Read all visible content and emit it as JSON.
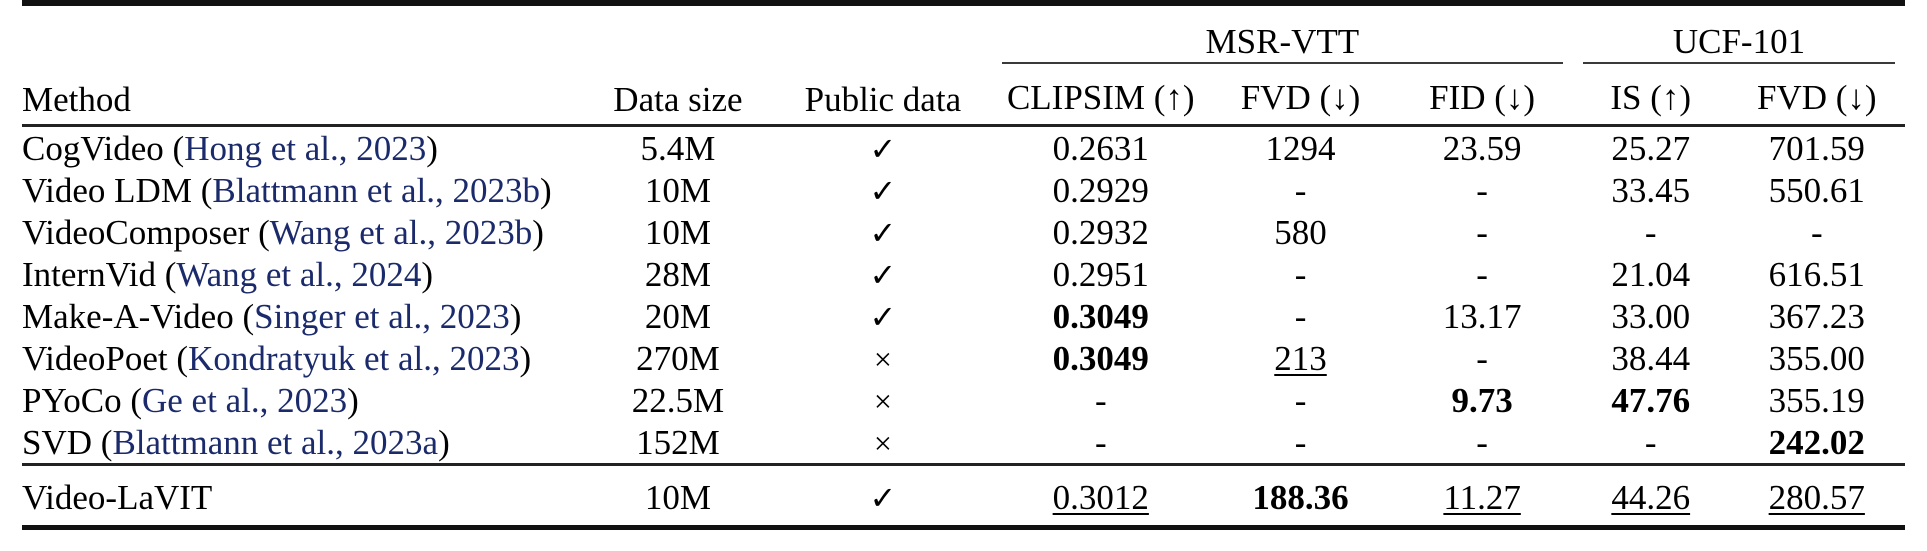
{
  "table": {
    "column_headers": {
      "method": "Method",
      "data_size": "Data size",
      "public_data": "Public data"
    },
    "group_headers": [
      {
        "label": "MSR-VTT",
        "span": 3
      },
      {
        "label": "UCF-101",
        "span": 2
      }
    ],
    "metric_headers": [
      "CLIPSIM (↑)",
      "FVD (↓)",
      "FID (↓)",
      "IS (↑)",
      "FVD (↓)"
    ],
    "icons": {
      "check": "✓",
      "cross": "×",
      "arrow_up": "↑",
      "arrow_down": "↓"
    },
    "citation_color": "#1b2a6b",
    "rows": [
      {
        "method_name": "CogVideo",
        "citation": "Hong et al., 2023",
        "data_size": "5.4M",
        "public_data": "✓",
        "clipsim": "0.2631",
        "clipsim_style": "plain",
        "msr_fvd": "1294",
        "msr_fvd_style": "plain",
        "fid": "23.59",
        "fid_style": "plain",
        "is": "25.27",
        "is_style": "plain",
        "ucf_fvd": "701.59",
        "ucf_fvd_style": "plain"
      },
      {
        "method_name": "Video LDM",
        "citation": "Blattmann et al., 2023b",
        "data_size": "10M",
        "public_data": "✓",
        "clipsim": "0.2929",
        "clipsim_style": "plain",
        "msr_fvd": "-",
        "msr_fvd_style": "plain",
        "fid": "-",
        "fid_style": "plain",
        "is": "33.45",
        "is_style": "plain",
        "ucf_fvd": "550.61",
        "ucf_fvd_style": "plain"
      },
      {
        "method_name": "VideoComposer",
        "citation": "Wang et al., 2023b",
        "data_size": "10M",
        "public_data": "✓",
        "clipsim": "0.2932",
        "clipsim_style": "plain",
        "msr_fvd": "580",
        "msr_fvd_style": "plain",
        "fid": "-",
        "fid_style": "plain",
        "is": "-",
        "is_style": "plain",
        "ucf_fvd": "-",
        "ucf_fvd_style": "plain"
      },
      {
        "method_name": "InternVid",
        "citation": "Wang et al., 2024",
        "data_size": "28M",
        "public_data": "✓",
        "clipsim": "0.2951",
        "clipsim_style": "plain",
        "msr_fvd": "-",
        "msr_fvd_style": "plain",
        "fid": "-",
        "fid_style": "plain",
        "is": "21.04",
        "is_style": "plain",
        "ucf_fvd": "616.51",
        "ucf_fvd_style": "plain"
      },
      {
        "method_name": "Make-A-Video",
        "citation": "Singer et al., 2023",
        "data_size": "20M",
        "public_data": "✓",
        "clipsim": "0.3049",
        "clipsim_style": "bold",
        "msr_fvd": "-",
        "msr_fvd_style": "plain",
        "fid": "13.17",
        "fid_style": "plain",
        "is": "33.00",
        "is_style": "plain",
        "ucf_fvd": "367.23",
        "ucf_fvd_style": "plain"
      },
      {
        "method_name": "VideoPoet",
        "citation": "Kondratyuk et al., 2023",
        "data_size": "270M",
        "public_data": "×",
        "clipsim": "0.3049",
        "clipsim_style": "bold",
        "msr_fvd": "213",
        "msr_fvd_style": "underline",
        "fid": "-",
        "fid_style": "plain",
        "is": "38.44",
        "is_style": "plain",
        "ucf_fvd": "355.00",
        "ucf_fvd_style": "plain"
      },
      {
        "method_name": "PYoCo",
        "citation": "Ge et al., 2023",
        "data_size": "22.5M",
        "public_data": "×",
        "clipsim": "-",
        "clipsim_style": "plain",
        "msr_fvd": "-",
        "msr_fvd_style": "plain",
        "fid": "9.73",
        "fid_style": "bold",
        "is": "47.76",
        "is_style": "bold",
        "ucf_fvd": "355.19",
        "ucf_fvd_style": "plain"
      },
      {
        "method_name": "SVD",
        "citation": "Blattmann et al., 2023a",
        "data_size": "152M",
        "public_data": "×",
        "clipsim": "-",
        "clipsim_style": "plain",
        "msr_fvd": "-",
        "msr_fvd_style": "plain",
        "fid": "-",
        "fid_style": "plain",
        "is": "-",
        "is_style": "plain",
        "ucf_fvd": "242.02",
        "ucf_fvd_style": "bold"
      }
    ],
    "final_row": {
      "method_name": "Video-LaVIT",
      "citation": "",
      "data_size": "10M",
      "public_data": "✓",
      "clipsim": "0.3012",
      "clipsim_style": "underline",
      "msr_fvd": "188.36",
      "msr_fvd_style": "bold",
      "fid": "11.27",
      "fid_style": "underline",
      "is": "44.26",
      "is_style": "underline",
      "ucf_fvd": "280.57",
      "ucf_fvd_style": "underline"
    }
  }
}
